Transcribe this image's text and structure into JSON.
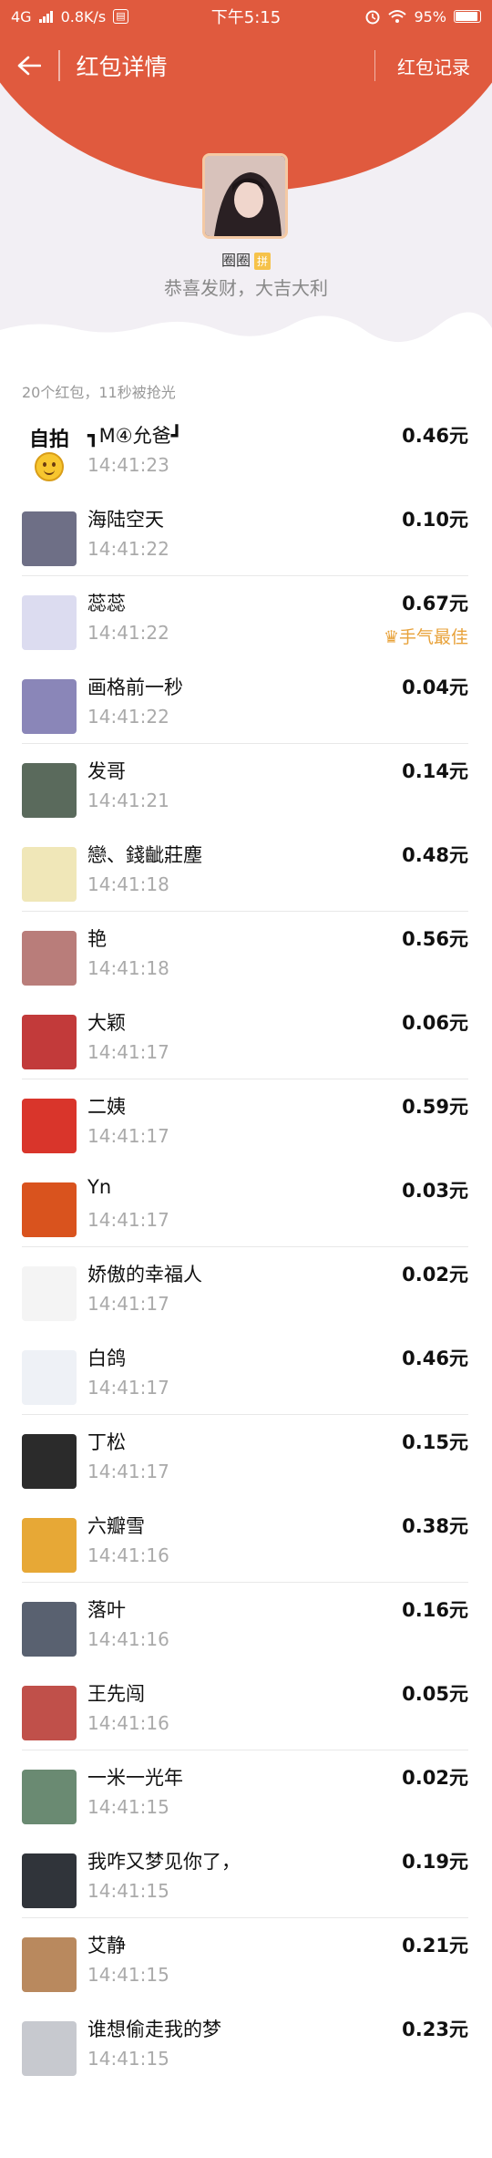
{
  "status_bar": {
    "network": "4G",
    "speed": "0.8K/s",
    "time": "下午5:15",
    "battery": "95%"
  },
  "header": {
    "title": "红包详情",
    "right_link": "红包记录"
  },
  "sender": {
    "name": "圈圈",
    "tag": "拼",
    "wish": "恭喜发财，大吉大利"
  },
  "summary": "20个红包，11秒被抢光",
  "entries": [
    {
      "avatar_label": "自拍",
      "name": "┓M④允爸┛",
      "time": "14:41:23",
      "amount": "0.46元",
      "best": "",
      "avatar_color": "#ffffff"
    },
    {
      "avatar_label": "",
      "name": "海陆空天",
      "time": "14:41:22",
      "amount": "0.10元",
      "best": "",
      "avatar_color": "#6e6f86"
    },
    {
      "avatar_label": "",
      "name": "蕊蕊",
      "time": "14:41:22",
      "amount": "0.67元",
      "best": "手气最佳",
      "avatar_color": "#dcdcf0"
    },
    {
      "avatar_label": "",
      "name": "画格前一秒",
      "time": "14:41:22",
      "amount": "0.04元",
      "best": "",
      "avatar_color": "#8a86b8"
    },
    {
      "avatar_label": "",
      "name": "发哥",
      "time": "14:41:21",
      "amount": "0.14元",
      "best": "",
      "avatar_color": "#5a6a5c"
    },
    {
      "avatar_label": "",
      "name": "戀、錢齜莊塵",
      "time": "14:41:18",
      "amount": "0.48元",
      "best": "",
      "avatar_color": "#f0e7b8"
    },
    {
      "avatar_label": "",
      "name": "艳",
      "time": "14:41:18",
      "amount": "0.56元",
      "best": "",
      "avatar_color": "#b97d7a"
    },
    {
      "avatar_label": "",
      "name": "大颖",
      "time": "14:41:17",
      "amount": "0.06元",
      "best": "",
      "avatar_color": "#c23a3a"
    },
    {
      "avatar_label": "",
      "name": "二姨",
      "time": "14:41:17",
      "amount": "0.59元",
      "best": "",
      "avatar_color": "#d9352b"
    },
    {
      "avatar_label": "",
      "name": "Yn",
      "time": "14:41:17",
      "amount": "0.03元",
      "best": "",
      "avatar_color": "#d9531e"
    },
    {
      "avatar_label": "",
      "name": "娇傲的幸福人",
      "time": "14:41:17",
      "amount": "0.02元",
      "best": "",
      "avatar_color": "#f4f4f4"
    },
    {
      "avatar_label": "",
      "name": "白鸽",
      "time": "14:41:17",
      "amount": "0.46元",
      "best": "",
      "avatar_color": "#eef1f6"
    },
    {
      "avatar_label": "",
      "name": "丁松",
      "time": "14:41:17",
      "amount": "0.15元",
      "best": "",
      "avatar_color": "#2b2b2b"
    },
    {
      "avatar_label": "",
      "name": "六瓣雪",
      "time": "14:41:16",
      "amount": "0.38元",
      "best": "",
      "avatar_color": "#e7a836"
    },
    {
      "avatar_label": "",
      "name": "落叶",
      "time": "14:41:16",
      "amount": "0.16元",
      "best": "",
      "avatar_color": "#596170"
    },
    {
      "avatar_label": "",
      "name": "王先闯",
      "time": "14:41:16",
      "amount": "0.05元",
      "best": "",
      "avatar_color": "#c0504a"
    },
    {
      "avatar_label": "",
      "name": "一米一光年",
      "time": "14:41:15",
      "amount": "0.02元",
      "best": "",
      "avatar_color": "#6a8a72"
    },
    {
      "avatar_label": "",
      "name": "我咋又梦见你了，",
      "time": "14:41:15",
      "amount": "0.19元",
      "best": "",
      "avatar_color": "#30343a"
    },
    {
      "avatar_label": "",
      "name": "艾静",
      "time": "14:41:15",
      "amount": "0.21元",
      "best": "",
      "avatar_color": "#b9895e"
    },
    {
      "avatar_label": "",
      "name": "谁想偷走我的梦",
      "time": "14:41:15",
      "amount": "0.23元",
      "best": "",
      "avatar_color": "#c7c9cf"
    }
  ]
}
